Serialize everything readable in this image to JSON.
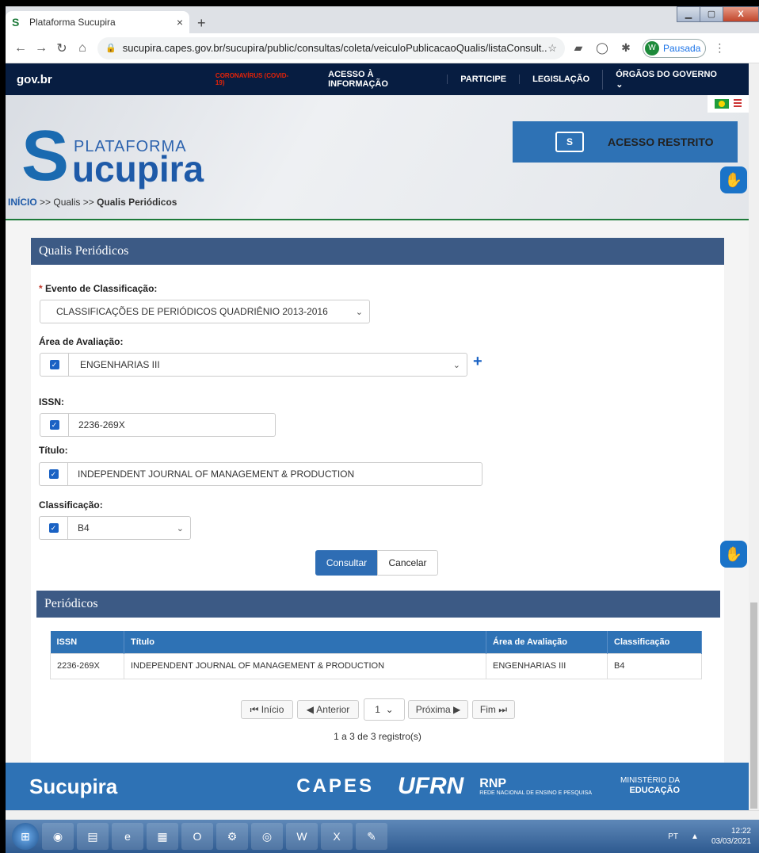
{
  "browser": {
    "tab_title": "Plataforma Sucupira",
    "tab_close": "×",
    "new_tab": "+",
    "url": "sucupira.capes.gov.br/sucupira/public/consultas/coleta/veiculoPublicacaoQualis/listaConsult...",
    "profile_initial": "W",
    "profile_status": "Pausada"
  },
  "govbar": {
    "logo": "gov.br",
    "covid": "CORONAVÍRUS (COVID-19)",
    "items": [
      "ACESSO À INFORMAÇÃO",
      "PARTICIPE",
      "LEGISLAÇÃO",
      "ÓRGÃOS DO GOVERNO"
    ]
  },
  "header": {
    "brand_small": "PLATAFORMA",
    "brand_name": "ucupira",
    "restricted_label": "ACESSO RESTRITO"
  },
  "breadcrumb": {
    "home": "INÍCIO",
    "sep": ">>",
    "qualis": "Qualis",
    "current": "Qualis Periódicos"
  },
  "form": {
    "section_title": "Qualis Periódicos",
    "evento_label": "Evento de Classificação:",
    "evento_value": "CLASSIFICAÇÕES DE PERIÓDICOS QUADRIÊNIO 2013-2016",
    "area_label": "Área de Avaliação:",
    "area_value": "ENGENHARIAS III",
    "issn_label": "ISSN:",
    "issn_value": "2236-269X",
    "titulo_label": "Título:",
    "titulo_value": "INDEPENDENT JOURNAL OF MANAGEMENT & PRODUCTION",
    "classificacao_label": "Classificação:",
    "classificacao_value": "B4",
    "consultar": "Consultar",
    "cancelar": "Cancelar"
  },
  "results": {
    "section_title": "Periódicos",
    "columns": [
      "ISSN",
      "Título",
      "Área de Avaliação",
      "Classificação"
    ],
    "rows": [
      [
        "2236-269X",
        "INDEPENDENT JOURNAL OF MANAGEMENT & PRODUCTION",
        "ENGENHARIAS III",
        "B4"
      ]
    ],
    "pager": {
      "first": "Início",
      "prev": "Anterior",
      "page": "1",
      "next": "Próxima",
      "last": "Fim"
    },
    "summary": "1 a 3 de 3 registro(s)"
  },
  "footer": {
    "sucupira": "ucupira",
    "capes": "CAPES",
    "ufrn": "UFRN",
    "rnp": "RNP",
    "rnp_sub": "REDE NACIONAL DE ENSINO E PESQUISA",
    "mec_top": "MINISTÉRIO DA",
    "mec_bottom": "EDUCAÇÃO"
  },
  "taskbar": {
    "lang": "PT",
    "time": "12:22",
    "date": "03/03/2021"
  }
}
